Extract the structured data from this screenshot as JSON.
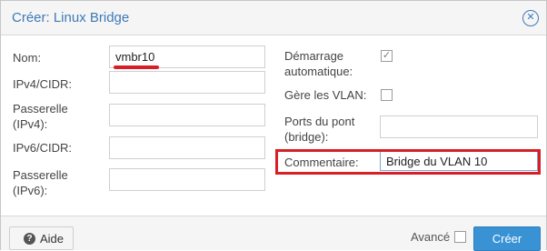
{
  "dialog": {
    "title": "Créer: Linux Bridge"
  },
  "left_column": {
    "name_label": "Nom:",
    "name_value": "vmbr10",
    "ipv4_label": "IPv4/CIDR:",
    "ipv4_value": "",
    "gateway4_label_line1": "Passerelle",
    "gateway4_label_line2": "(IPv4):",
    "gateway4_value": "",
    "ipv6_label": "IPv6/CIDR:",
    "ipv6_value": "",
    "gateway6_label_line1": "Passerelle",
    "gateway6_label_line2": "(IPv6):",
    "gateway6_value": ""
  },
  "right_column": {
    "autostart_label_line1": "Démarrage",
    "autostart_label_line2": "automatique:",
    "autostart_checked": true,
    "vlan_label": "Gère les VLAN:",
    "vlan_checked": false,
    "ports_label_line1": "Ports du pont",
    "ports_label_line2": "(bridge):",
    "ports_value": "",
    "comment_label": "Commentaire:",
    "comment_value": "Bridge du VLAN 10"
  },
  "footer": {
    "help_label": "Aide",
    "help_icon_glyph": "?",
    "advanced_label": "Avancé",
    "advanced_checked": false,
    "create_label": "Créer"
  },
  "colors": {
    "accent": "#3892d4",
    "title": "#3d7ab8",
    "highlight": "#d81f26"
  },
  "icons": {
    "close": "close-circle-icon",
    "help": "help-circle-icon",
    "check": "checkmark-icon"
  }
}
